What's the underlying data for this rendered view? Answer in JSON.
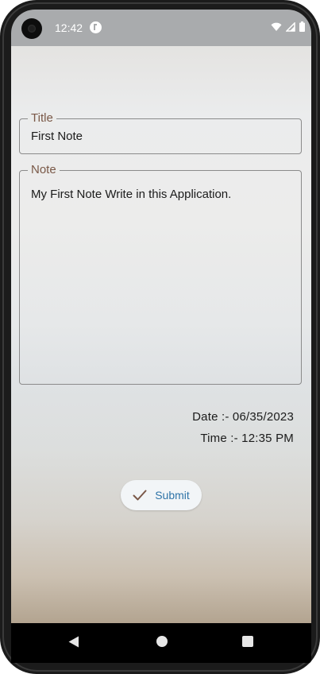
{
  "status_bar": {
    "time": "12:42",
    "icons": [
      "camera-cutout",
      "app-notification-icon",
      "wifi-icon",
      "signal-icon",
      "battery-icon"
    ]
  },
  "form": {
    "title_label": "Title",
    "title_value": "First Note",
    "note_label": "Note",
    "note_value": "My First Note Write in this Application."
  },
  "meta": {
    "date": "Date :- 06/35/2023",
    "time": "Time :- 12:35 PM"
  },
  "actions": {
    "submit_label": "Submit",
    "submit_icon": "check-icon"
  },
  "nav_bar": {
    "buttons": [
      "back-icon",
      "home-icon",
      "recents-icon"
    ]
  },
  "colors": {
    "label_accent": "#7a5848",
    "submit_text": "#2f74a8",
    "status_bar_bg": "#a9abad"
  }
}
